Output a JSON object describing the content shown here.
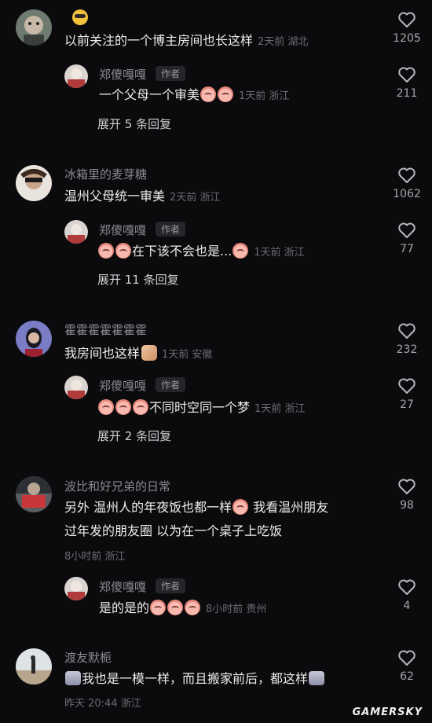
{
  "comments": [
    {
      "username_emoji": "nerd-face",
      "text": "以前关注的一个博主房间也长这样",
      "meta": "2天前 湖北",
      "likes": "1205",
      "reply": {
        "username": "郑傻嘎嘎",
        "badge": "作者",
        "text": "一个父母一个审美",
        "meta": "1天前 浙江",
        "likes": "211"
      },
      "expand": "展开 5 条回复"
    },
    {
      "username": "冰箱里的麦芽糖",
      "text": "温州父母统一审美",
      "meta": "2天前 浙江",
      "likes": "1062",
      "reply": {
        "username": "郑傻嘎嘎",
        "badge": "作者",
        "text": "在下该不会也是...",
        "meta": "1天前 浙江",
        "likes": "77"
      },
      "expand": "展开 11 条回复"
    },
    {
      "username": "霍霍霍霍霍霍霍",
      "text": "我房间也这样",
      "meta": "1天前 安徽",
      "likes": "232",
      "reply": {
        "username": "郑傻嘎嘎",
        "badge": "作者",
        "text": "不同时空同一个梦",
        "meta": "1天前 浙江",
        "likes": "27"
      },
      "expand": "展开 2 条回复"
    },
    {
      "username": "波比和好兄弟的日常",
      "text_line1a": "另外 温州人的年夜饭也都一样",
      "text_line1b": "我看温州朋友",
      "text_line2": "过年发的朋友圈 以为在一个桌子上吃饭",
      "meta": "8小时前 浙江",
      "likes": "98",
      "reply": {
        "username": "郑傻嘎嘎",
        "badge": "作者",
        "text": "是的是的",
        "meta": "8小时前 贵州",
        "likes": "4"
      }
    },
    {
      "username": "渡友默栀",
      "text_a": "我也是一模一样，而且搬家前后，都这样",
      "meta": "昨天 20:44 浙江",
      "likes": "62"
    }
  ],
  "watermark": "GAMERSKY",
  "colors": {
    "background": "#0b0b0d",
    "text": "#ededee",
    "muted": "#6d6d72",
    "username": "#8a8a8f"
  }
}
